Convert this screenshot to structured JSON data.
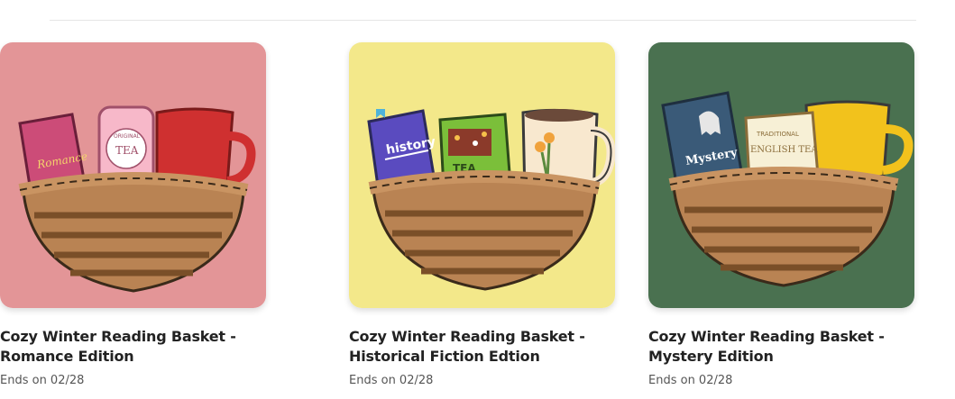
{
  "cards": [
    {
      "title": "Cozy Winter Reading Basket -\nHistorical Fiction Edtion",
      "ends": "Ends on 02/28",
      "bg": "#f3e88a",
      "book_label": "history",
      "tea_label": "TEA",
      "icon": "history-tea-basket-illustration"
    },
    {
      "title": "Cozy Winter Reading Basket -\nMystery Edition",
      "ends": "Ends on 02/28",
      "bg": "#4a7150",
      "book_label": "Mystery",
      "tea_label_top": "TRADITIONAL",
      "tea_label": "ENGLISH TEA",
      "icon": "mystery-tea-basket-illustration"
    },
    {
      "title": "Cozy Winter Reading Basket -\nRomance Edition",
      "ends": "Ends on 02/28",
      "bg": "#e39597",
      "book_label": "Romance",
      "tea_label_top": "ORIGINAL",
      "tea_label": "TEA",
      "icon": "romance-tea-basket-illustration"
    }
  ]
}
